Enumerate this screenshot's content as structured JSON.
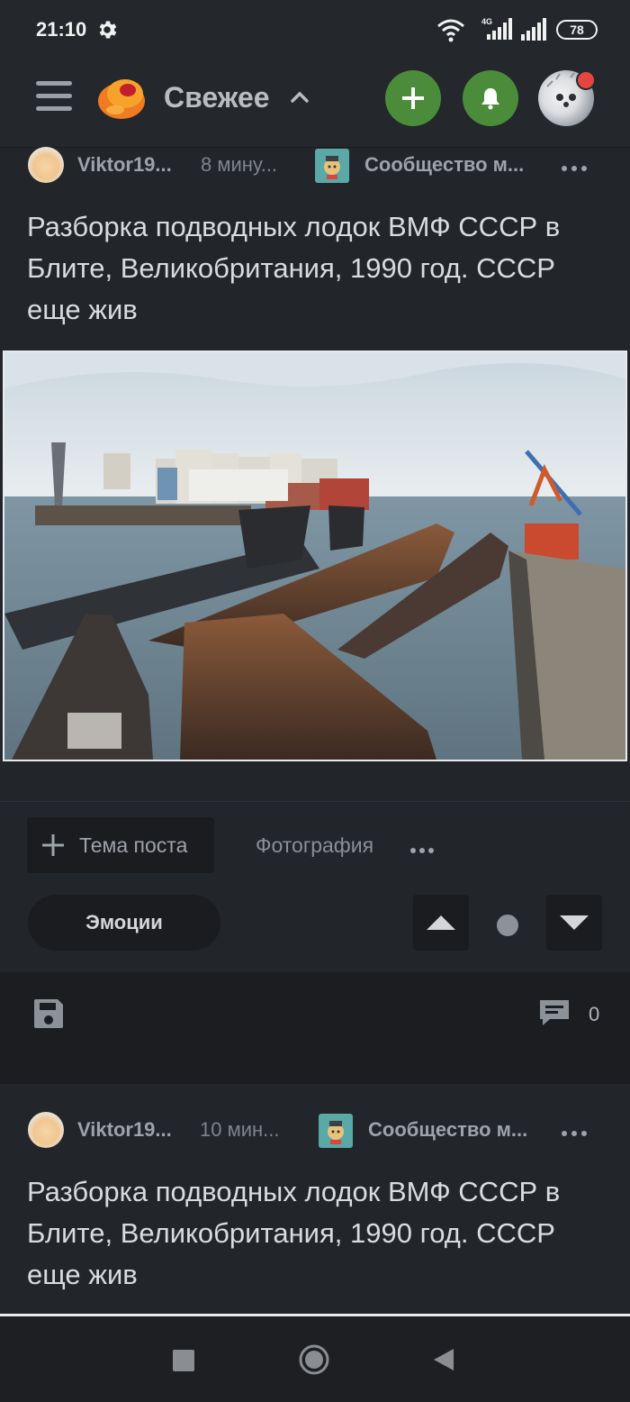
{
  "status_bar": {
    "time": "21:10",
    "network": "4G",
    "battery": "78"
  },
  "header": {
    "feed_label": "Свежее",
    "icons": [
      "menu-icon",
      "logo",
      "chevron-up-icon",
      "add-icon",
      "bell-icon",
      "avatar"
    ],
    "accent_color": "#4b8c3a",
    "notification_color": "#e2463f"
  },
  "posts": [
    {
      "author": "Viktor19...",
      "time": "8 мину...",
      "community": "Сообщество м...",
      "title": "Разборка подводных лодок ВМФ СССР в Блите, Великобритания, 1990 год. СССР еще жив",
      "tags": {
        "add_tag_label": "Тема поста",
        "tag_photo": "Фотография"
      },
      "emotions_label": "Эмоции",
      "comments_count": "0"
    },
    {
      "author": "Viktor19...",
      "time": "10 мин...",
      "community": "Сообщество м...",
      "title": "Разборка подводных лодок ВМФ СССР в Блите, Великобритания, 1990 год. СССР еще жив"
    }
  ]
}
